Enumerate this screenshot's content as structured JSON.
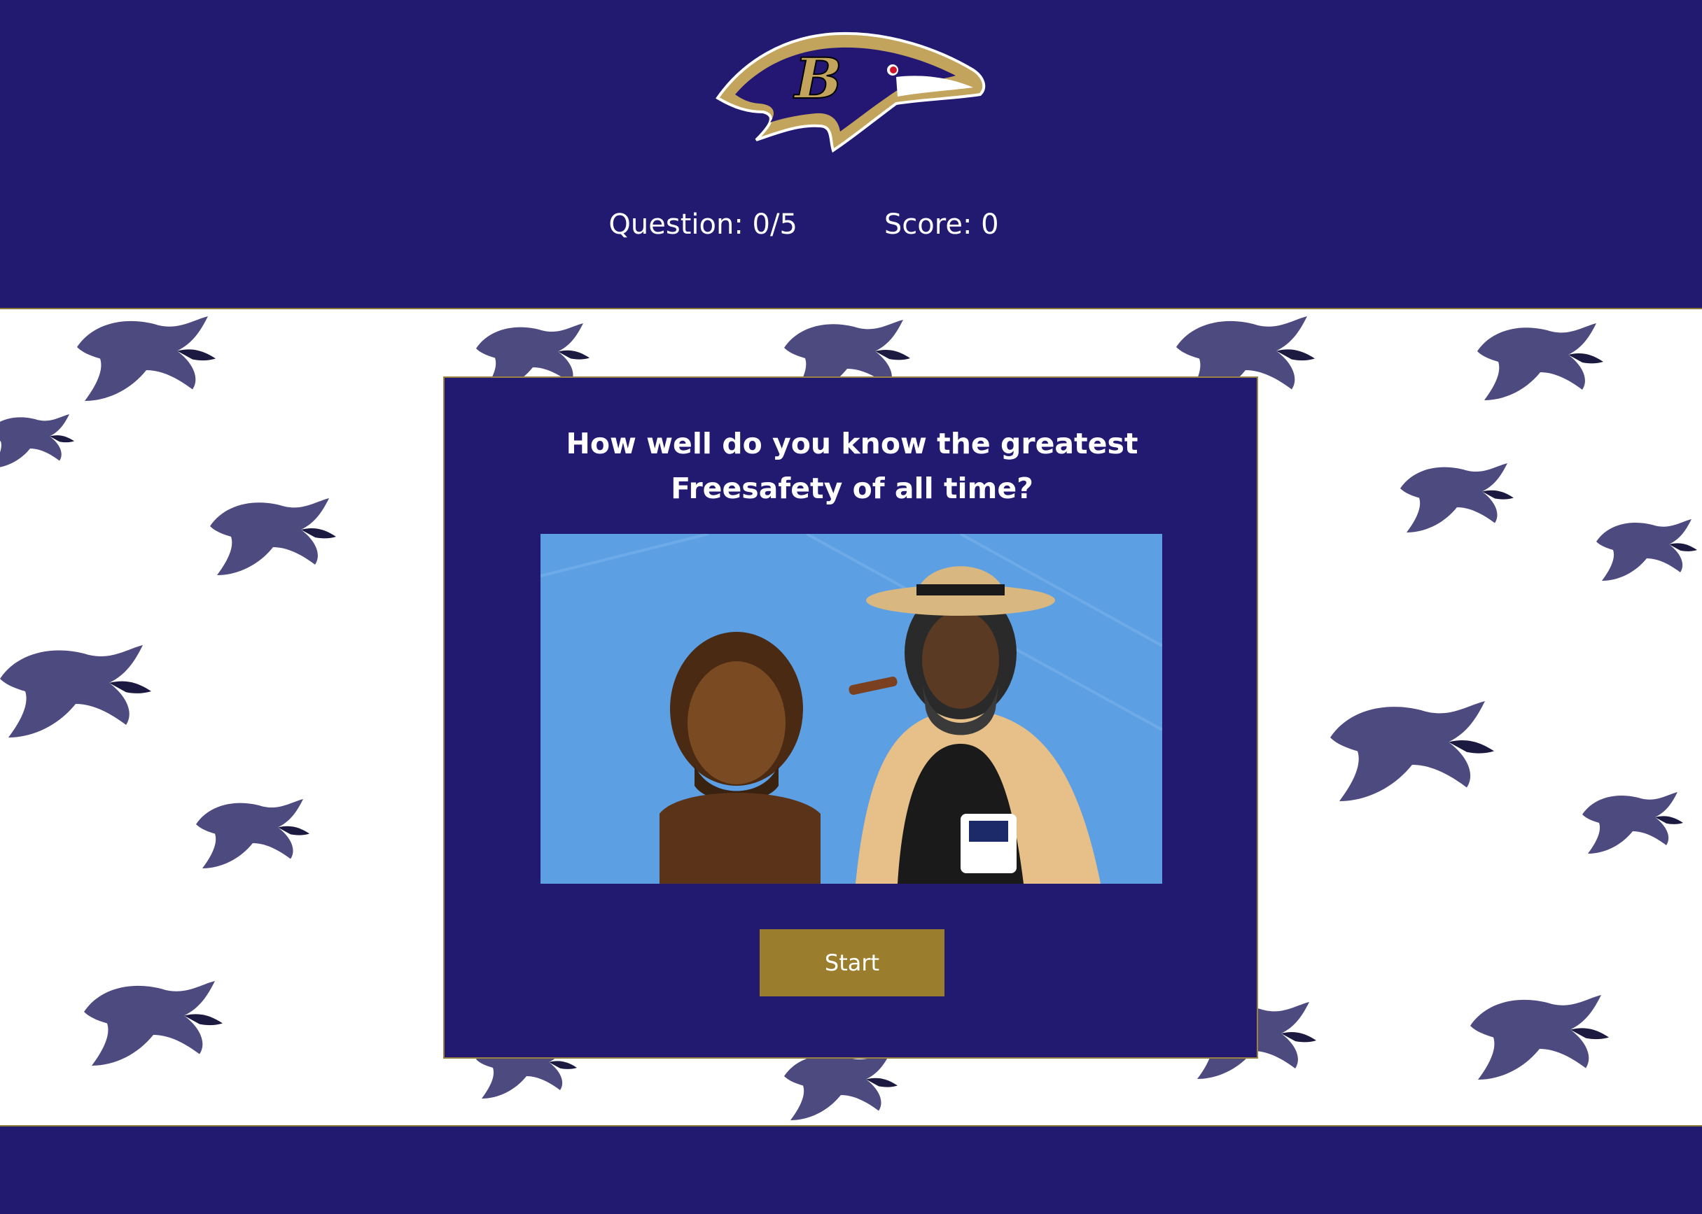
{
  "header": {
    "logo_icon": "baltimore-ravens-logo-icon",
    "question_label": "Question: 0/5",
    "score_label": "Score: 0"
  },
  "quiz": {
    "question": "How well do you know the greatest Freesafety of all time?",
    "image_icon": "hall-of-fame-bust-photo",
    "start_label": "Start"
  },
  "background": {
    "pattern_icon": "raven-pattern-icon"
  },
  "colors": {
    "primary": "#211a70",
    "gold": "#9a7e2d",
    "white": "#ffffff"
  }
}
